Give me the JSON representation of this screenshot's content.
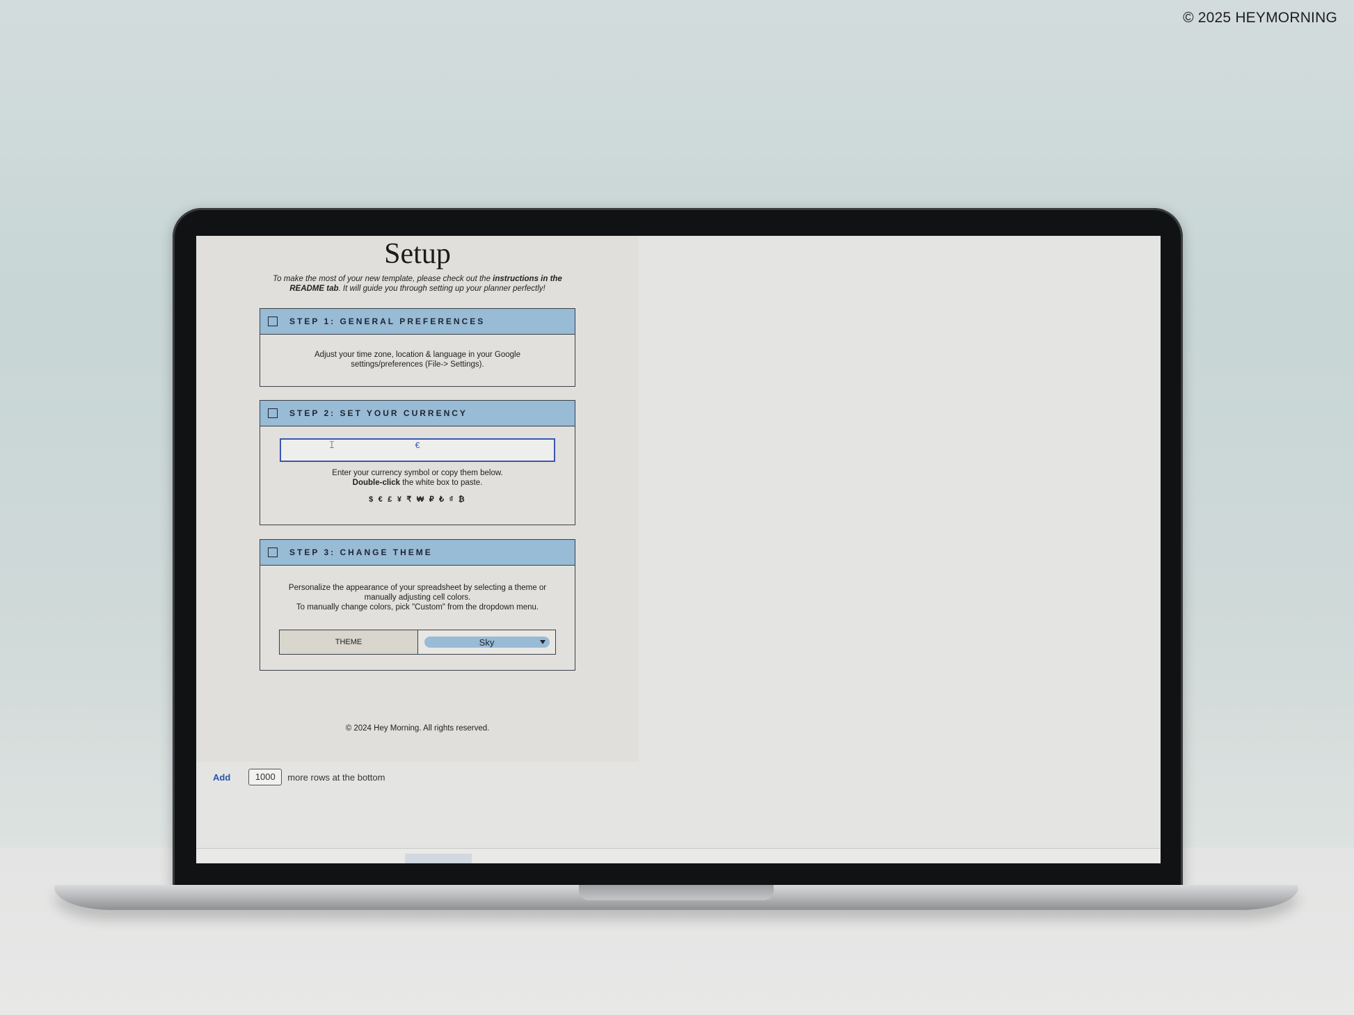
{
  "watermark": "© 2025 HEYMORNING",
  "sheet": {
    "title": "Setup",
    "intro": {
      "prefix": "To make the most of your new template, please check out the ",
      "bold": "instructions in the README tab",
      "suffix": ". It will guide you through setting up your planner perfectly!"
    },
    "steps": [
      {
        "label": "STEP 1: GENERAL PREFERENCES",
        "text_line1": "Adjust your time zone, location & language in your Google",
        "text_line2": "settings/preferences (File-> Settings)."
      },
      {
        "label": "STEP 2: SET YOUR CURRENCY",
        "input_value": "€",
        "text_line1": "Enter your currency symbol or copy them below.",
        "text_bold": "Double-click",
        "text_line2_rest": " the white box to paste.",
        "symbols": "$ € £ ¥ ₹ ₩ ₽ ₺ ₫ ₿"
      },
      {
        "label": "STEP 3: CHANGE THEME",
        "text_line1": "Personalize the appearance of your spreadsheet by selecting a theme or",
        "text_line2": "manually adjusting cell colors.",
        "text_line3": "To manually change colors, pick \"Custom\" from the dropdown menu.",
        "theme_label": "THEME",
        "theme_value": "Sky"
      }
    ],
    "copyright": "© 2024 Hey Morning. All rights reserved."
  },
  "add_rows": {
    "link": "Add",
    "count": "1000",
    "suffix": "more rows at the bottom"
  },
  "colors": {
    "step_header": "#98bbd6",
    "panel": "#e0dfdb",
    "input_border": "#3a56b3",
    "link": "#2457a7"
  }
}
